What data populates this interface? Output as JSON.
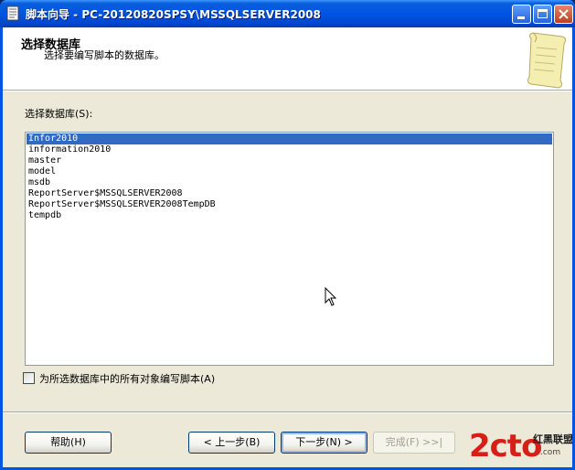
{
  "window": {
    "title": "脚本向导 - PC-20120820SPSY\\MSSQLSERVER2008"
  },
  "header": {
    "title": "选择数据库",
    "subtitle": "选择要编写脚本的数据库。"
  },
  "database_label": "选择数据库(S):",
  "databases": [
    "Infor2010",
    "information2010",
    "master",
    "model",
    "msdb",
    "ReportServer$MSSQLSERVER2008",
    "ReportServer$MSSQLSERVER2008TempDB",
    "tempdb"
  ],
  "selected_database": "Infor2010",
  "script_all_checkbox": {
    "label": "为所选数据库中的所有对象编写脚本(A)",
    "checked": false
  },
  "buttons": {
    "help": "帮助(H)",
    "back": "< 上一步(B)",
    "next": "下一步(N) >",
    "finish": "完成(F) >>|"
  },
  "watermark": {
    "logo": "2cto",
    "name": "红黑联盟",
    "url": ".com"
  },
  "colors": {
    "title_bar": "#0054e3",
    "selection": "#316ac5",
    "dialog_bg": "#ece9d8"
  },
  "icons": {
    "window_icon": "document-icon",
    "header_image": "scroll-icon"
  }
}
